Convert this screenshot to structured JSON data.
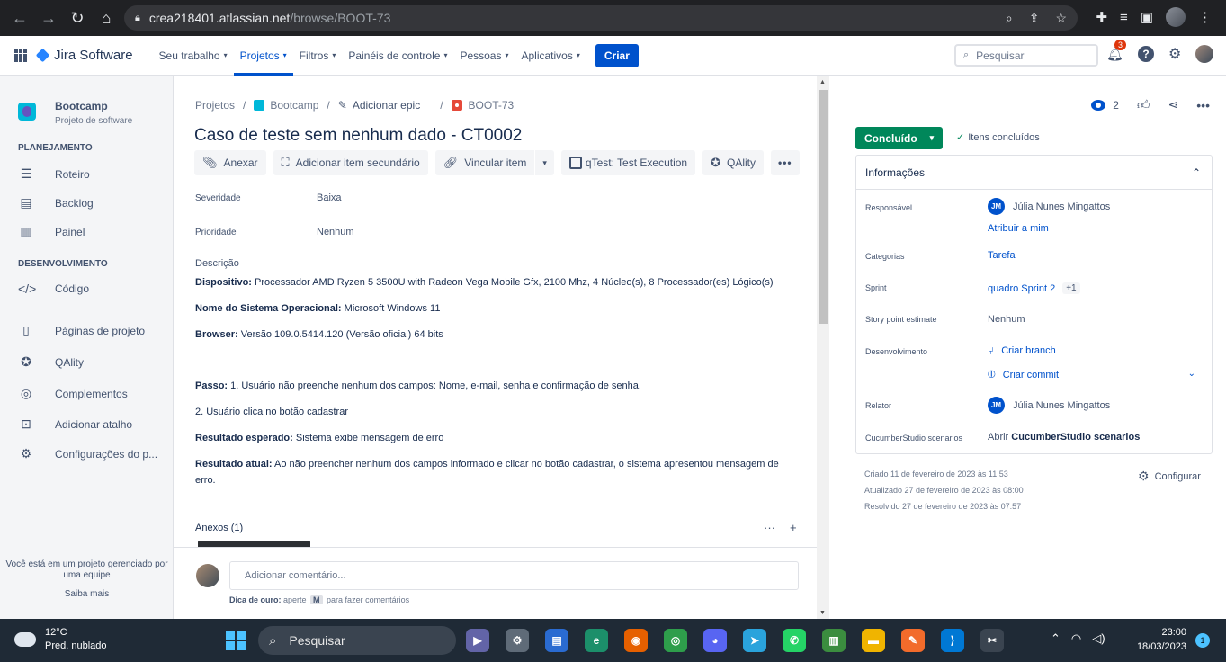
{
  "browser": {
    "url_domain": "crea218401.atlassian.net",
    "url_path": "/browse/BOOT-73"
  },
  "topnav": {
    "logo": "Jira Software",
    "menu": [
      "Seu trabalho",
      "Projetos",
      "Filtros",
      "Painéis de controle",
      "Pessoas",
      "Aplicativos"
    ],
    "create": "Criar",
    "search_placeholder": "Pesquisar",
    "notif_count": "3"
  },
  "sidebar": {
    "project_name": "Bootcamp",
    "project_type": "Projeto de software",
    "section_planning": "PLANEJAMENTO",
    "planning_items": [
      "Roteiro",
      "Backlog",
      "Painel"
    ],
    "section_dev": "DESENVOLVIMENTO",
    "dev_items": [
      "Código",
      "Páginas de projeto",
      "QAlity",
      "Complementos",
      "Adicionar atalho",
      "Configurações do p..."
    ],
    "footer_text": "Você está em um projeto gerenciado por uma equipe",
    "footer_link": "Saiba mais"
  },
  "issue": {
    "crumb_projects": "Projetos",
    "crumb_project": "Bootcamp",
    "crumb_epic": "Adicionar epic",
    "crumb_key": "BOOT-73",
    "title": "Caso de teste sem nenhum dado - CT0002",
    "actions": [
      "Anexar",
      "Adicionar item secundário",
      "Vincular item",
      "qTest: Test Execution",
      "QAlity"
    ],
    "severity_label": "Severidade",
    "severity_value": "Baixa",
    "priority_label": "Prioridade",
    "priority_value": "Nenhum",
    "description_label": "Descrição",
    "desc": {
      "device_label": "Dispositivo:",
      "device_value": " Processador AMD Ryzen 5 3500U with Radeon Vega Mobile Gfx, 2100 Mhz, 4 Núcleo(s), 8 Processador(es) Lógico(s)",
      "os_label": "Nome do Sistema Operacional:",
      "os_value": " Microsoft Windows 11",
      "browser_label": "Browser:",
      "browser_value": " Versão 109.0.5414.120 (Versão oficial) 64 bits",
      "step_label": "Passo:",
      "step_value": " 1. Usuário não preenche nenhum dos campos: Nome, e-mail, senha e confirmação de senha.",
      "step2": "2. Usuário clica no botão cadastrar",
      "expected_label": "Resultado esperado:",
      "expected_value": " Sistema exibe mensagem de erro",
      "actual_label": "Resultado atual:",
      "actual_value": " Ao não preencher nenhum dos campos informado e clicar no botão cadastrar, o sistema apresentou mensagem de erro."
    },
    "attachments": "Anexos (1)",
    "comment_placeholder": "Adicionar comentário...",
    "tip_bold": "Dica de ouro:",
    "tip_text1": " aperte ",
    "tip_key": "M",
    "tip_text2": " para fazer comentários"
  },
  "details": {
    "watch_count": "2",
    "status": "Concluído",
    "resolution": "Itens concluídos",
    "panel_title": "Informações",
    "assignee_label": "Responsável",
    "assignee": "Júlia Nunes Mingattos",
    "assignee_initials": "JM",
    "assign_me": "Atribuir a mim",
    "labels_label": "Categorias",
    "labels_value": "Tarefa",
    "sprint_label": "Sprint",
    "sprint_value": "quadro Sprint 2",
    "sprint_more": "+1",
    "sp_label": "Story point estimate",
    "sp_value": "Nenhum",
    "dev_label": "Desenvolvimento",
    "dev_branch": "Criar branch",
    "dev_commit": "Criar commit",
    "reporter_label": "Relator",
    "reporter": "Júlia Nunes Mingattos",
    "cucumber_label": "CucumberStudio scenarios",
    "cucumber_pre": "Abrir ",
    "cucumber_bold": "CucumberStudio scenarios",
    "created": "Criado 11 de fevereiro de 2023 às 11:53",
    "updated": "Atualizado 27 de fevereiro de 2023 às 08:00",
    "resolved": "Resolvido 27 de fevereiro de 2023 às 07:57",
    "configure": "Configurar"
  },
  "taskbar": {
    "temp": "12°C",
    "weather": "Pred. nublado",
    "search": "Pesquisar",
    "time": "23:00",
    "date": "18/03/2023",
    "notif": "1"
  }
}
